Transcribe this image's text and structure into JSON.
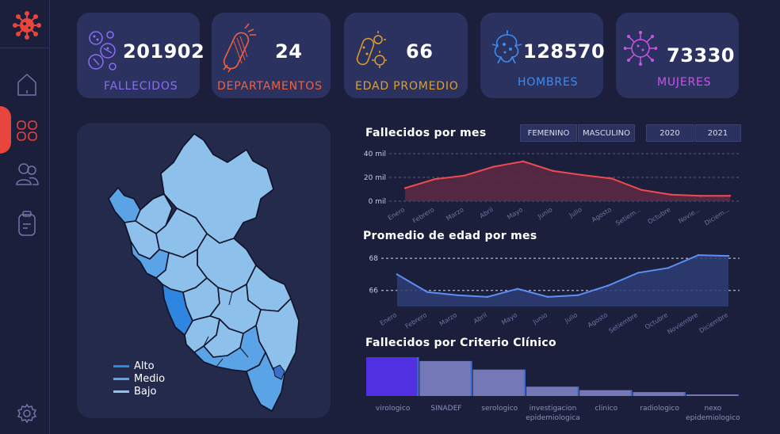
{
  "kpis": [
    {
      "value": "201902",
      "label": "FALLECIDOS",
      "color": "#8b6cf6",
      "icon": "virus-cells-icon"
    },
    {
      "value": "24",
      "label": "DEPARTAMENTOS",
      "color": "#f0613f",
      "icon": "bacteria-rod-icon"
    },
    {
      "value": "66",
      "label": "EDAD PROMEDIO",
      "color": "#e0a028",
      "icon": "microbe-icon"
    },
    {
      "value": "128570",
      "label": "HOMBRES",
      "color": "#3c8cf0",
      "icon": "germ-icon"
    },
    {
      "value": "73330",
      "label": "MUJERES",
      "color": "#c955e8",
      "icon": "coronavirus-icon"
    }
  ],
  "filters": {
    "gender": [
      "FEMENINO",
      "MASCULINO"
    ],
    "years": [
      "2020",
      "2021"
    ]
  },
  "map": {
    "legend": [
      {
        "label": "Alto",
        "color": "#2f86e0"
      },
      {
        "label": "Medio",
        "color": "#5aa3e6"
      },
      {
        "label": "Bajo",
        "color": "#8ec0ec"
      }
    ]
  },
  "chart_data": [
    {
      "type": "area",
      "title": "Fallecidos por mes",
      "categories": [
        "Enero",
        "Febrero",
        "Marzo",
        "Abril",
        "Mayo",
        "Junio",
        "Julio",
        "Agosto",
        "Setiem...",
        "Octubre",
        "Novie...",
        "Diciem..."
      ],
      "values": [
        11000,
        18500,
        21500,
        29000,
        33500,
        25500,
        22000,
        19000,
        9500,
        5500,
        4500,
        4500
      ],
      "yticks": [
        "0 mil",
        "20 mil",
        "40 mil"
      ],
      "ylim": [
        0,
        40000
      ],
      "colors": {
        "line": "#ef4a4f",
        "fill": "#5e2a44"
      }
    },
    {
      "type": "area",
      "title": "Promedio de edad por mes",
      "categories": [
        "Enero",
        "Febrero",
        "Marzo",
        "Abril",
        "Mayo",
        "Junio",
        "Julio",
        "Agosto",
        "Setiembre",
        "Octubre",
        "Noviembre",
        "Diciembre"
      ],
      "values": [
        67.0,
        65.9,
        65.7,
        65.6,
        66.1,
        65.6,
        65.7,
        66.3,
        67.1,
        67.4,
        68.2,
        68.15
      ],
      "yticks": [
        "66",
        "68"
      ],
      "ylim": [
        65,
        68.6
      ],
      "colors": {
        "line": "#5b8ff5",
        "fill": "#2d3d74"
      }
    },
    {
      "type": "bar",
      "title": "Fallecidos por Criterio Clínico",
      "categories": [
        "virologico",
        "SINADEF",
        "serologico",
        "investigacion epidemiologica",
        "clinico",
        "radiologico",
        "nexo epidemiologico"
      ],
      "values": [
        100,
        90,
        68,
        24,
        15,
        10,
        4
      ],
      "colors": {
        "highlight": "#5030e0",
        "bar": "#7478b6",
        "edge": "#3e6fd8"
      }
    }
  ]
}
